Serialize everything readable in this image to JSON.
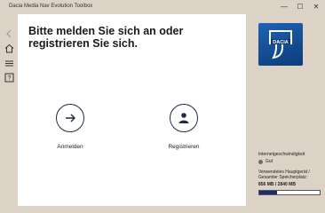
{
  "window": {
    "title": "Dacia Media Nav Evolution Toolbox"
  },
  "main": {
    "heading": "Bitte melden Sie sich an oder registrieren Sie sich.",
    "login_label": "Anmelden",
    "register_label": "Registrieren"
  },
  "sidebar": {
    "internet_speed_label": "Internetgeschwindigkeit",
    "internet_speed_value": "Gut",
    "storage_label": "Verwendetes Hauptgerät / Gesamter Speicherplatz:",
    "storage_value": "856 MB / 2840 MB",
    "storage_fraction": 0.3014
  },
  "colors": {
    "accent": "#1f2a44",
    "brand": "#1e63b4",
    "background": "#ddd2c6"
  },
  "icons": [
    "back-icon",
    "home-icon",
    "menu-icon",
    "help-icon",
    "login-icon",
    "user-icon",
    "dacia-logo"
  ]
}
